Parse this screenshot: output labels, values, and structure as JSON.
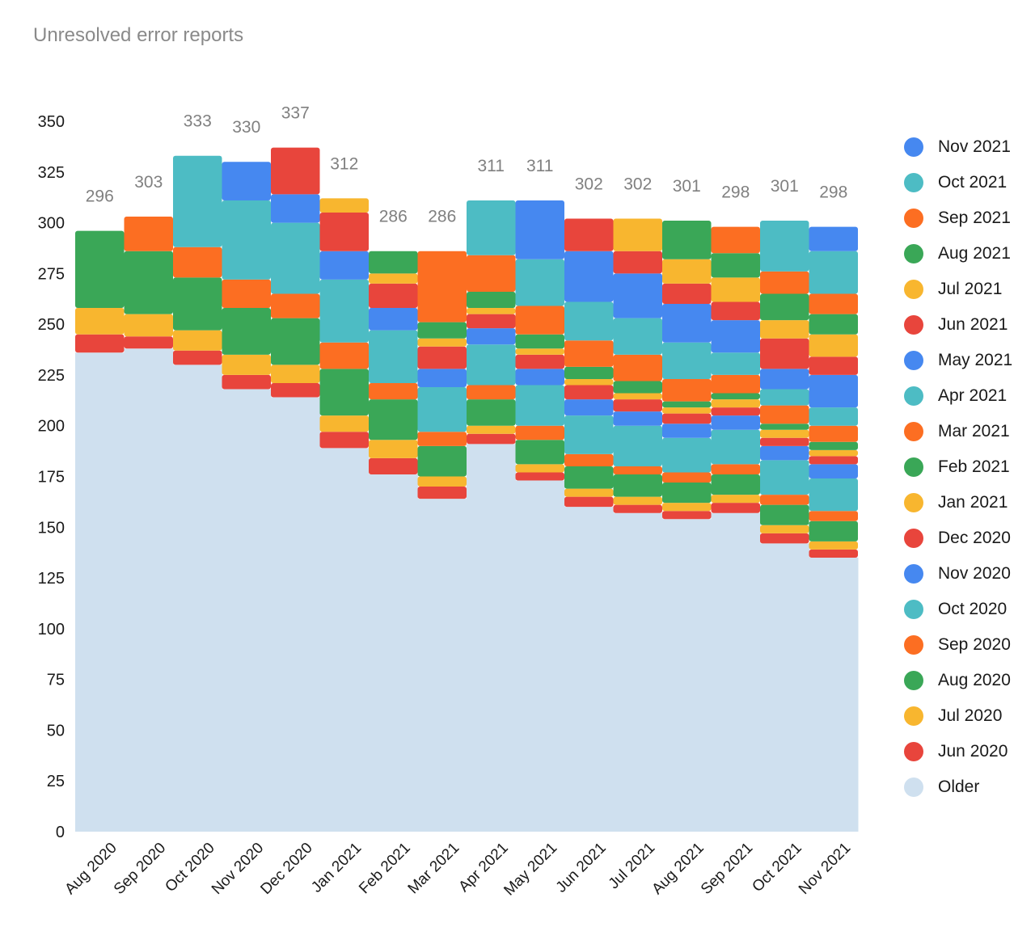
{
  "chart_data": {
    "type": "area",
    "subtype": "stacked-step",
    "title": "Unresolved error reports",
    "xlabel": "",
    "ylabel": "",
    "ylim": [
      0,
      350
    ],
    "yticks": [
      0,
      25,
      50,
      75,
      100,
      125,
      150,
      175,
      200,
      225,
      250,
      275,
      300,
      325,
      350
    ],
    "grid": false,
    "legend_position": "right",
    "categories": [
      "Aug 2020",
      "Sep 2020",
      "Oct 2020",
      "Nov 2020",
      "Dec 2020",
      "Jan 2021",
      "Feb 2021",
      "Mar 2021",
      "Apr 2021",
      "May 2021",
      "Jun 2021",
      "Jul 2021",
      "Aug 2021",
      "Sep 2021",
      "Oct 2021",
      "Nov 2021"
    ],
    "totals": [
      296,
      303,
      333,
      330,
      337,
      312,
      286,
      286,
      311,
      311,
      302,
      302,
      301,
      298,
      301,
      298
    ],
    "series": [
      {
        "name": "Older",
        "color": "#cfe0ef",
        "values": [
          236,
          238,
          230,
          218,
          214,
          189,
          176,
          164,
          191,
          173,
          160,
          157,
          154,
          157,
          142,
          135
        ]
      },
      {
        "name": "Jun 2020",
        "color": "#e8453c",
        "values": [
          9,
          6,
          7,
          7,
          7,
          8,
          8,
          6,
          5,
          4,
          5,
          4,
          4,
          5,
          5,
          4
        ]
      },
      {
        "name": "Jul 2020",
        "color": "#f8b62f",
        "values": [
          13,
          11,
          10,
          10,
          9,
          8,
          9,
          5,
          4,
          4,
          4,
          4,
          4,
          4,
          4,
          4
        ]
      },
      {
        "name": "Aug 2020",
        "color": "#3aa757",
        "values": [
          38,
          31,
          26,
          23,
          23,
          23,
          20,
          15,
          13,
          12,
          11,
          11,
          10,
          10,
          10,
          10
        ]
      },
      {
        "name": "Sep 2020",
        "color": "#fc6e22",
        "values": [
          0,
          17,
          15,
          14,
          12,
          13,
          8,
          7,
          7,
          7,
          6,
          4,
          5,
          5,
          5,
          5
        ]
      },
      {
        "name": "Oct 2020",
        "color": "#4dbcc4",
        "values": [
          0,
          0,
          45,
          39,
          35,
          31,
          26,
          22,
          20,
          20,
          19,
          20,
          17,
          17,
          17,
          16
        ]
      },
      {
        "name": "Nov 2020",
        "color": "#4688f0",
        "values": [
          0,
          0,
          0,
          19,
          14,
          14,
          11,
          9,
          8,
          8,
          8,
          7,
          7,
          7,
          7,
          7
        ]
      },
      {
        "name": "Dec 2020",
        "color": "#e8453c",
        "values": [
          0,
          0,
          0,
          0,
          23,
          19,
          12,
          11,
          7,
          7,
          7,
          6,
          5,
          4,
          4,
          4
        ]
      },
      {
        "name": "Jan 2021",
        "color": "#f8b62f",
        "values": [
          0,
          0,
          0,
          0,
          0,
          7,
          5,
          4,
          3,
          3,
          3,
          3,
          3,
          4,
          4,
          3
        ]
      },
      {
        "name": "Feb 2021",
        "color": "#3aa757",
        "values": [
          0,
          0,
          0,
          0,
          0,
          0,
          11,
          8,
          8,
          7,
          6,
          6,
          3,
          3,
          3,
          4
        ]
      },
      {
        "name": "Mar 2021",
        "color": "#fc6e22",
        "values": [
          0,
          0,
          0,
          0,
          0,
          0,
          0,
          35,
          18,
          14,
          13,
          13,
          11,
          9,
          9,
          8
        ]
      },
      {
        "name": "Apr 2021",
        "color": "#4dbcc4",
        "values": [
          0,
          0,
          0,
          0,
          0,
          0,
          0,
          0,
          27,
          23,
          19,
          18,
          18,
          11,
          8,
          9
        ]
      },
      {
        "name": "May 2021",
        "color": "#4688f0",
        "values": [
          0,
          0,
          0,
          0,
          0,
          0,
          0,
          0,
          0,
          29,
          25,
          22,
          19,
          16,
          10,
          16
        ]
      },
      {
        "name": "Jun 2021",
        "color": "#e8453c",
        "values": [
          0,
          0,
          0,
          0,
          0,
          0,
          0,
          0,
          0,
          0,
          16,
          11,
          10,
          9,
          15,
          9
        ]
      },
      {
        "name": "Jul 2021",
        "color": "#f8b62f",
        "values": [
          0,
          0,
          0,
          0,
          0,
          0,
          0,
          0,
          0,
          0,
          0,
          16,
          12,
          12,
          9,
          11
        ]
      },
      {
        "name": "Aug 2021",
        "color": "#3aa757",
        "values": [
          0,
          0,
          0,
          0,
          0,
          0,
          0,
          0,
          0,
          0,
          0,
          0,
          19,
          12,
          13,
          10
        ]
      },
      {
        "name": "Sep 2021",
        "color": "#fc6e22",
        "values": [
          0,
          0,
          0,
          0,
          0,
          0,
          0,
          0,
          0,
          0,
          0,
          0,
          0,
          13,
          11,
          10
        ]
      },
      {
        "name": "Oct 2021",
        "color": "#4dbcc4",
        "values": [
          0,
          0,
          0,
          0,
          0,
          0,
          0,
          0,
          0,
          0,
          0,
          0,
          0,
          0,
          25,
          21
        ]
      },
      {
        "name": "Nov 2021",
        "color": "#4688f0",
        "values": [
          0,
          0,
          0,
          0,
          0,
          0,
          0,
          0,
          0,
          0,
          0,
          0,
          0,
          0,
          0,
          12
        ]
      }
    ],
    "legend_order": [
      "Nov 2021",
      "Oct 2021",
      "Sep 2021",
      "Aug 2021",
      "Jul 2021",
      "Jun 2021",
      "May 2021",
      "Apr 2021",
      "Mar 2021",
      "Feb 2021",
      "Jan 2021",
      "Dec 2020",
      "Nov 2020",
      "Oct 2020",
      "Sep 2020",
      "Aug 2020",
      "Jul 2020",
      "Jun 2020",
      "Older"
    ]
  }
}
